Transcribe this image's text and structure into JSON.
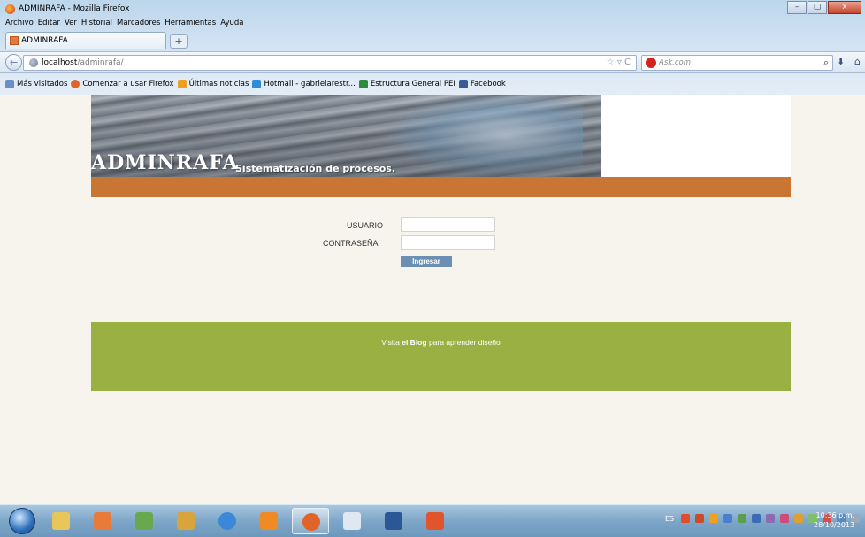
{
  "window": {
    "title": "ADMINRAFA - Mozilla Firefox",
    "controls": [
      "–",
      "▢",
      "x"
    ]
  },
  "menu": [
    "Archivo",
    "Editar",
    "Ver",
    "Historial",
    "Marcadores",
    "Herramientas",
    "Ayuda"
  ],
  "tab": {
    "label": "ADMINRAFA",
    "new_tab": "+"
  },
  "nav": {
    "back": "←",
    "url_host": "localhost",
    "url_path": "/adminrafa/",
    "url_right": "☆ ▿ C",
    "search_placeholder": "Ask.com",
    "search_go": "⌕",
    "download": "⬇",
    "home": "⌂"
  },
  "bookmarks": [
    {
      "label": "Más visitados",
      "color": "#6a8fc4"
    },
    {
      "label": "Comenzar a usar Firefox",
      "color": "#e0642a"
    },
    {
      "label": "Últimas noticias",
      "color": "#f0a020"
    },
    {
      "label": "Hotmail - gabrielarestr...",
      "color": "#2e8bd8"
    },
    {
      "label": "Estructura General PEI",
      "color": "#2d8a3e"
    },
    {
      "label": "Facebook",
      "color": "#3b5998"
    }
  ],
  "header": {
    "title": "ADMINRAFA",
    "subtitle": "Sistematización de procesos."
  },
  "login": {
    "user_label": "USUARIO",
    "password_label": "CONTRASEÑA",
    "user_value": "",
    "password_value": "",
    "submit": "Ingresar"
  },
  "footer": {
    "prefix": "Visita",
    "link": "el Blog",
    "suffix": "para aprender diseño"
  },
  "taskbar": {
    "apps": [
      {
        "name": "explorer",
        "color": "#e8c65a"
      },
      {
        "name": "media-player",
        "color": "#e87a3a"
      },
      {
        "name": "notepad-green",
        "color": "#6aa84f"
      },
      {
        "name": "paint-tool",
        "color": "#d9a43b"
      },
      {
        "name": "internet-explorer",
        "color": "#3b88d8"
      },
      {
        "name": "vlc",
        "color": "#f08a24"
      },
      {
        "name": "firefox",
        "color": "#e0642a"
      },
      {
        "name": "sql-tool",
        "color": "#dfe8f1"
      },
      {
        "name": "word",
        "color": "#2b5797"
      },
      {
        "name": "office",
        "color": "#e2542b"
      }
    ],
    "lang": "ES",
    "time": "10:36 p.m.",
    "date": "28/10/2013"
  }
}
